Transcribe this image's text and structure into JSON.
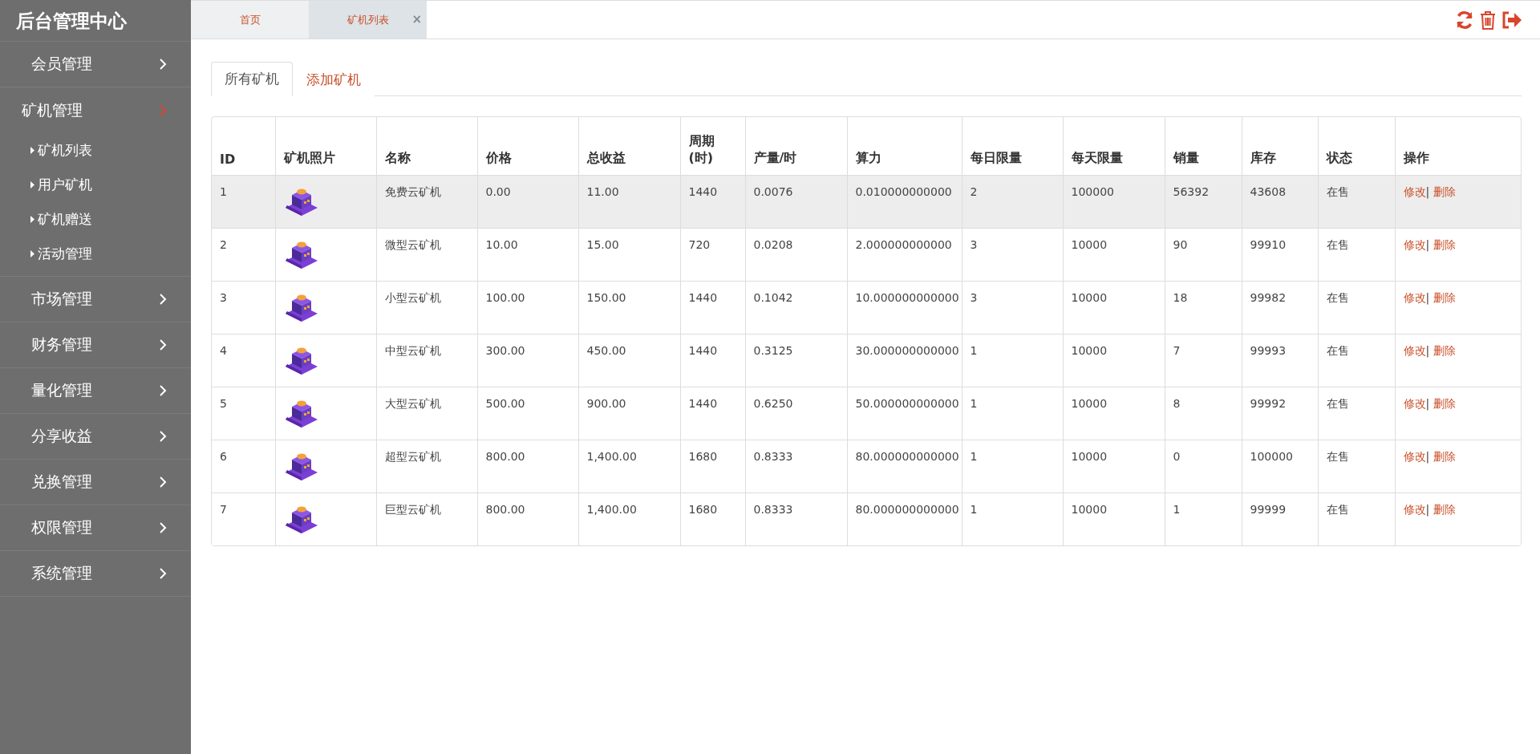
{
  "sidebar": {
    "title": "后台管理中心",
    "items": [
      {
        "label": "会员管理",
        "expanded": false
      },
      {
        "label": "矿机管理",
        "expanded": true,
        "children": [
          {
            "label": "矿机列表"
          },
          {
            "label": "用户矿机"
          },
          {
            "label": "矿机赠送"
          },
          {
            "label": "活动管理"
          }
        ]
      },
      {
        "label": "市场管理",
        "expanded": false
      },
      {
        "label": "财务管理",
        "expanded": false
      },
      {
        "label": "量化管理",
        "expanded": false
      },
      {
        "label": "分享收益",
        "expanded": false
      },
      {
        "label": "兑换管理",
        "expanded": false
      },
      {
        "label": "权限管理",
        "expanded": false
      },
      {
        "label": "系统管理",
        "expanded": false
      }
    ]
  },
  "page_tabs": [
    {
      "label": "首页",
      "selected": false,
      "closable": false
    },
    {
      "label": "矿机列表",
      "selected": true,
      "closable": true
    }
  ],
  "close_glyph": "×",
  "content_tabs": [
    {
      "label": "所有矿机",
      "selected": true
    },
    {
      "label": "添加矿机",
      "selected": false
    }
  ],
  "table": {
    "columns": [
      "ID",
      "矿机照片",
      "名称",
      "价格",
      "总收益",
      "周期\n(时)",
      "产量/时",
      "算力",
      "每日限量",
      "每天限量",
      "销量",
      "库存",
      "状态",
      "操作"
    ],
    "rows": [
      {
        "highlighted": true,
        "cells": [
          "1",
          "",
          "免费云矿机",
          "0.00",
          "11.00",
          "1440",
          "0.0076",
          "0.010000000000",
          "2",
          "100000",
          "56392",
          "43608",
          "在售"
        ],
        "actions": [
          "修改",
          "删除"
        ]
      },
      {
        "highlighted": false,
        "cells": [
          "2",
          "",
          "微型云矿机",
          "10.00",
          "15.00",
          "720",
          "0.0208",
          "2.000000000000",
          "3",
          "10000",
          "90",
          "99910",
          "在售"
        ],
        "actions": [
          "修改",
          "删除"
        ]
      },
      {
        "highlighted": false,
        "cells": [
          "3",
          "",
          "小型云矿机",
          "100.00",
          "150.00",
          "1440",
          "0.1042",
          "10.000000000000",
          "3",
          "10000",
          "18",
          "99982",
          "在售"
        ],
        "actions": [
          "修改",
          "删除"
        ]
      },
      {
        "highlighted": false,
        "cells": [
          "4",
          "",
          "中型云矿机",
          "300.00",
          "450.00",
          "1440",
          "0.3125",
          "30.000000000000",
          "1",
          "10000",
          "7",
          "99993",
          "在售"
        ],
        "actions": [
          "修改",
          "删除"
        ]
      },
      {
        "highlighted": false,
        "cells": [
          "5",
          "",
          "大型云矿机",
          "500.00",
          "900.00",
          "1440",
          "0.6250",
          "50.000000000000",
          "1",
          "10000",
          "8",
          "99992",
          "在售"
        ],
        "actions": [
          "修改",
          "删除"
        ]
      },
      {
        "highlighted": false,
        "cells": [
          "6",
          "",
          "超型云矿机",
          "800.00",
          "1,400.00",
          "1680",
          "0.8333",
          "80.000000000000",
          "1",
          "10000",
          "0",
          "100000",
          "在售"
        ],
        "actions": [
          "修改",
          "删除"
        ]
      },
      {
        "highlighted": false,
        "cells": [
          "7",
          "",
          "巨型云矿机",
          "800.00",
          "1,400.00",
          "1680",
          "0.8333",
          "80.000000000000",
          "1",
          "10000",
          "1",
          "99999",
          "在售"
        ],
        "actions": [
          "修改",
          "删除"
        ]
      }
    ]
  },
  "action_separator": "|"
}
